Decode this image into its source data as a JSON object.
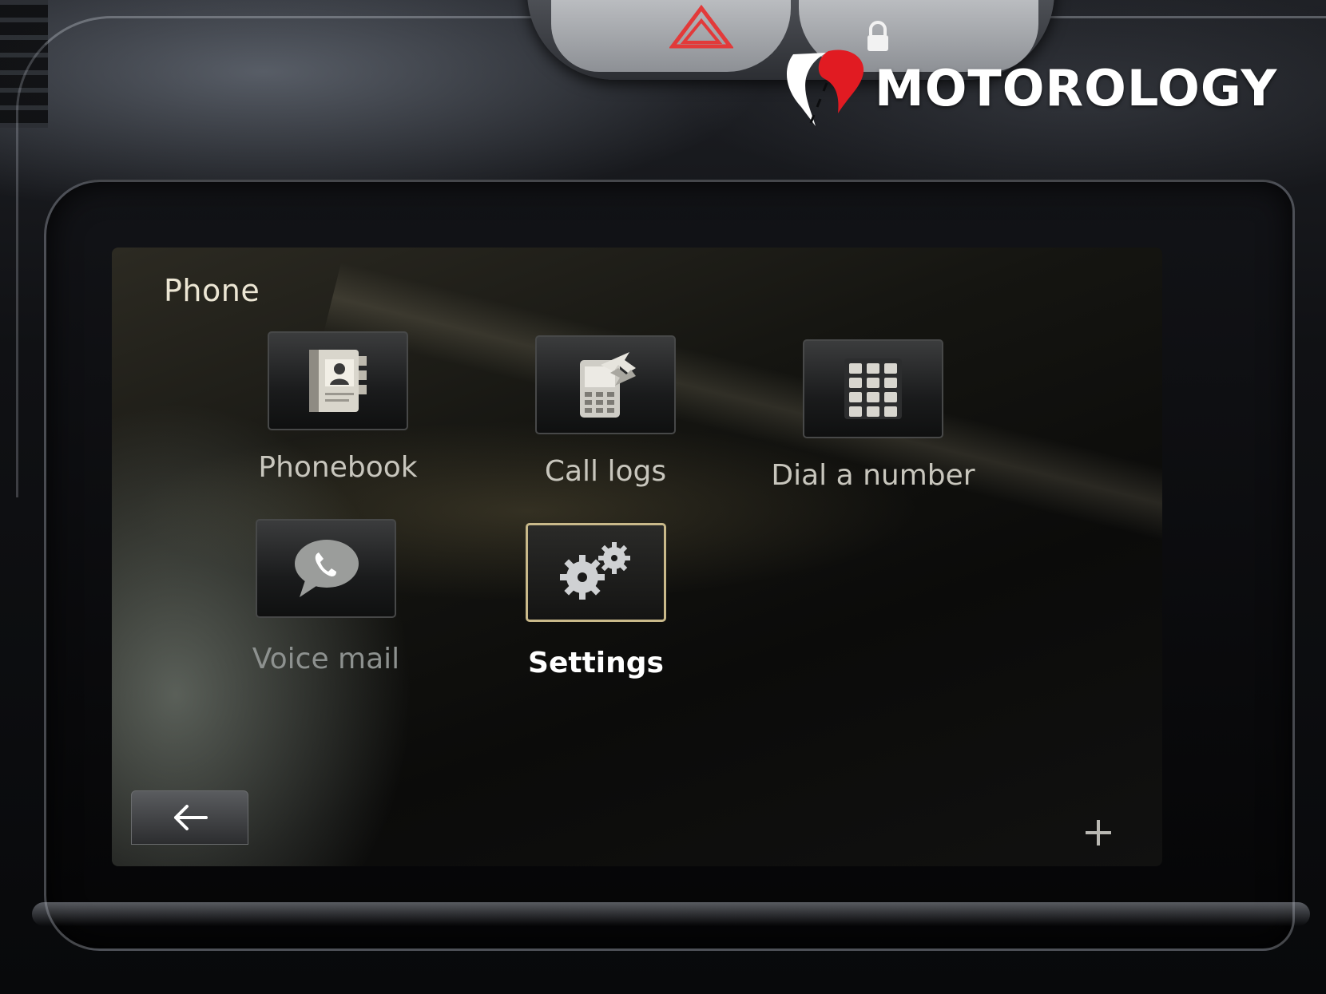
{
  "screen": {
    "title": "Phone",
    "items": [
      {
        "label": "Phonebook",
        "icon": "phonebook-icon"
      },
      {
        "label": "Call logs",
        "icon": "call-logs-icon"
      },
      {
        "label": "Dial a number",
        "icon": "dialpad-icon"
      },
      {
        "label": "Voice mail",
        "icon": "voicemail-icon"
      },
      {
        "label": "Settings",
        "icon": "gears-icon",
        "selected": true
      }
    ],
    "back_icon": "back-arrow-icon",
    "plus_icon": "plus-icon"
  },
  "watermark": {
    "brand": "MOTOROLOGY"
  },
  "colors": {
    "selected_border": "#c9b98a",
    "hazard_red": "#e23a3a",
    "logo_red": "#e11b22"
  }
}
